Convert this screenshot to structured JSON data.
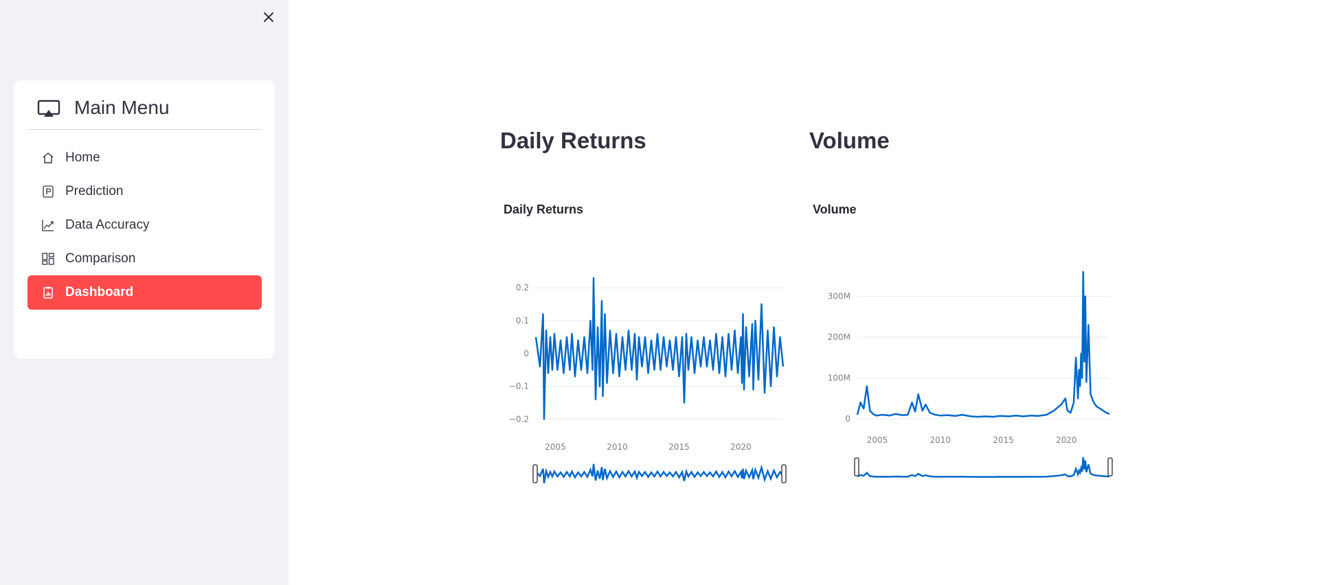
{
  "sidebar": {
    "menu_title": "Main Menu",
    "items": [
      {
        "label": "Home",
        "icon": "house-icon",
        "active": false
      },
      {
        "label": "Prediction",
        "icon": "p-square-icon",
        "active": false
      },
      {
        "label": "Data Accuracy",
        "icon": "graph-up-icon",
        "active": false
      },
      {
        "label": "Comparison",
        "icon": "grid-icon",
        "active": false
      },
      {
        "label": "Dashboard",
        "icon": "clipboard-data-icon",
        "active": true
      }
    ],
    "accent_color": "#ff4b4b"
  },
  "sections": [
    {
      "heading": "Daily Returns"
    },
    {
      "heading": "Volume"
    }
  ],
  "chart_data": [
    {
      "type": "line",
      "title": "Daily Returns",
      "x_range": [
        "2003-06",
        "2023-06"
      ],
      "x_ticks": [
        "2005",
        "2010",
        "2015",
        "2020"
      ],
      "ylim": [
        -0.22,
        0.24
      ],
      "y_ticks": [
        -0.2,
        -0.1,
        0,
        0.1,
        0.2
      ],
      "y_tick_labels": [
        "−0.2",
        "−0.1",
        "0",
        "0.1",
        "0.2"
      ],
      "grid": true,
      "color": "#0068c9",
      "range_slider": true,
      "series": [
        {
          "x": [
            "2003-06",
            "2003-10",
            "2004-01",
            "2004-02",
            "2004-04",
            "2004-06",
            "2004-08",
            "2004-10",
            "2004-12",
            "2005-03",
            "2005-06",
            "2005-09",
            "2005-12",
            "2006-03",
            "2006-05",
            "2006-08",
            "2006-11",
            "2007-02",
            "2007-05",
            "2007-08",
            "2007-11",
            "2008-01",
            "2008-02",
            "2008-04",
            "2008-06",
            "2008-08",
            "2008-10",
            "2008-11",
            "2009-01",
            "2009-03",
            "2009-06",
            "2009-09",
            "2009-12",
            "2010-03",
            "2010-06",
            "2010-09",
            "2010-12",
            "2011-03",
            "2011-06",
            "2011-08",
            "2011-10",
            "2012-01",
            "2012-04",
            "2012-07",
            "2012-10",
            "2013-01",
            "2013-04",
            "2013-07",
            "2013-10",
            "2014-01",
            "2014-04",
            "2014-07",
            "2014-10",
            "2015-01",
            "2015-04",
            "2015-06",
            "2015-08",
            "2015-10",
            "2016-01",
            "2016-04",
            "2016-07",
            "2016-10",
            "2017-01",
            "2017-04",
            "2017-07",
            "2017-10",
            "2018-01",
            "2018-04",
            "2018-07",
            "2018-10",
            "2019-01",
            "2019-04",
            "2019-07",
            "2019-10",
            "2020-01",
            "2020-02",
            "2020-03",
            "2020-04",
            "2020-06",
            "2020-09",
            "2020-12",
            "2021-01",
            "2021-03",
            "2021-06",
            "2021-09",
            "2021-12",
            "2022-03",
            "2022-06",
            "2022-09",
            "2022-12",
            "2023-03",
            "2023-06"
          ],
          "y": [
            0.05,
            -0.04,
            0.12,
            -0.2,
            0.07,
            -0.06,
            0.05,
            -0.05,
            0.06,
            -0.05,
            0.04,
            -0.06,
            0.05,
            -0.05,
            0.06,
            -0.07,
            0.04,
            -0.05,
            0.05,
            -0.06,
            0.1,
            -0.05,
            0.23,
            -0.14,
            0.08,
            -0.1,
            0.16,
            -0.13,
            0.12,
            -0.09,
            0.07,
            -0.06,
            0.06,
            -0.07,
            0.05,
            -0.05,
            0.07,
            -0.05,
            0.06,
            -0.08,
            0.05,
            -0.04,
            0.05,
            -0.06,
            0.04,
            -0.05,
            0.06,
            -0.05,
            0.05,
            -0.04,
            0.04,
            -0.05,
            0.05,
            -0.07,
            0.05,
            -0.15,
            0.06,
            -0.05,
            0.05,
            -0.06,
            0.04,
            -0.04,
            0.05,
            -0.04,
            0.04,
            -0.05,
            0.06,
            -0.06,
            0.05,
            -0.07,
            0.06,
            -0.05,
            0.07,
            -0.06,
            0.05,
            -0.09,
            0.12,
            -0.11,
            0.08,
            -0.07,
            0.09,
            -0.11,
            0.1,
            -0.08,
            0.15,
            -0.12,
            0.07,
            -0.1,
            0.08,
            -0.07,
            0.05,
            -0.04
          ]
        }
      ]
    },
    {
      "type": "line",
      "title": "Volume",
      "x_range": [
        "2003-06",
        "2023-06"
      ],
      "x_ticks": [
        "2005",
        "2010",
        "2015",
        "2020"
      ],
      "ylim": [
        0,
        370000000
      ],
      "y_ticks": [
        0,
        100000000,
        200000000,
        300000000
      ],
      "y_tick_labels": [
        "0",
        "100M",
        "200M",
        "300M"
      ],
      "grid": true,
      "color": "#0068c9",
      "range_slider": true,
      "series": [
        {
          "x": [
            "2003-06",
            "2003-09",
            "2003-12",
            "2004-03",
            "2004-06",
            "2004-09",
            "2004-12",
            "2005-06",
            "2006-01",
            "2006-06",
            "2007-01",
            "2007-06",
            "2007-10",
            "2008-01",
            "2008-04",
            "2008-08",
            "2008-11",
            "2009-03",
            "2009-08",
            "2010-01",
            "2010-08",
            "2011-03",
            "2011-10",
            "2012-06",
            "2013-01",
            "2013-08",
            "2014-03",
            "2014-10",
            "2015-06",
            "2016-01",
            "2016-08",
            "2017-03",
            "2017-10",
            "2018-06",
            "2019-01",
            "2019-08",
            "2019-12",
            "2020-02",
            "2020-05",
            "2020-08",
            "2020-10",
            "2020-12",
            "2021-01",
            "2021-02",
            "2021-03",
            "2021-04",
            "2021-05",
            "2021-06",
            "2021-07",
            "2021-08",
            "2021-10",
            "2021-12",
            "2022-03",
            "2022-06",
            "2022-09",
            "2022-12",
            "2023-03",
            "2023-06"
          ],
          "y": [
            10000000,
            40000000,
            25000000,
            80000000,
            20000000,
            12000000,
            8000000,
            10000000,
            8000000,
            12000000,
            9000000,
            10000000,
            40000000,
            18000000,
            60000000,
            20000000,
            35000000,
            15000000,
            10000000,
            8000000,
            9000000,
            7000000,
            10000000,
            6000000,
            5000000,
            6000000,
            5000000,
            7000000,
            6000000,
            8000000,
            6000000,
            8000000,
            7000000,
            10000000,
            20000000,
            35000000,
            50000000,
            20000000,
            15000000,
            40000000,
            150000000,
            50000000,
            120000000,
            80000000,
            160000000,
            100000000,
            360000000,
            140000000,
            300000000,
            90000000,
            230000000,
            60000000,
            40000000,
            30000000,
            25000000,
            20000000,
            15000000,
            12000000
          ]
        }
      ]
    }
  ]
}
